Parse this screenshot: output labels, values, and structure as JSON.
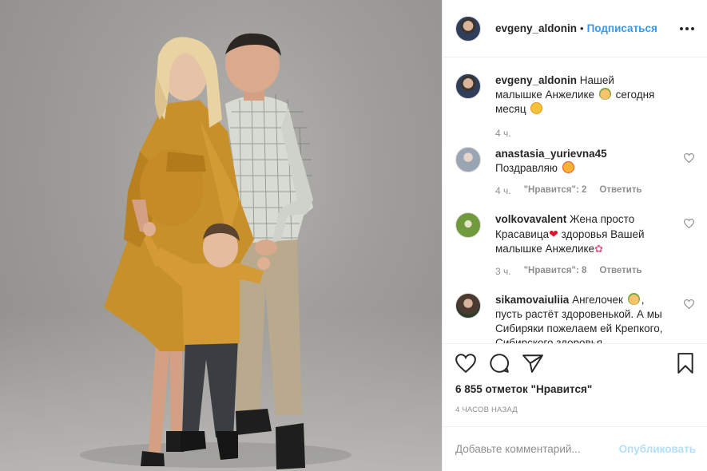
{
  "header": {
    "username": "evgeny_aldonin",
    "separator": "•",
    "follow_label": "Подписаться"
  },
  "caption": {
    "username": "evgeny_aldonin",
    "text_part1": "Нашей малышке Анжелике",
    "text_part2": "сегодня месяц",
    "time": "4 ч."
  },
  "comments": [
    {
      "username": "anastasia_yurievna45",
      "text": "Поздравляю",
      "time": "4 ч.",
      "likes": "\"Нравится\": 2",
      "reply": "Ответить"
    },
    {
      "username": "volkovavalent",
      "text_part1": "Жена просто Красавица",
      "text_part2": "здоровья Вашей малышке Анжелике",
      "time": "3 ч.",
      "likes": "\"Нравится\": 8",
      "reply": "Ответить"
    },
    {
      "username": "sikamovaiuliia",
      "text_part1": "Ангелочек",
      "text_part2": ", пусть растёт здоровенькой. А мы Сибиряки пожелаем ей Крепкого, Сибирского здоровья"
    }
  ],
  "likes_count": "6 855 отметок \"Нравится\"",
  "time_ago": "4 ЧАСОВ НАЗАД",
  "add_comment": {
    "placeholder": "Добавьте комментарий...",
    "publish_label": "Опубликовать"
  },
  "colors": {
    "accent": "#3897f0",
    "publish_disabled": "#b2dffc",
    "meta_gray": "#8e8e8e",
    "dress": "#c8902a"
  },
  "icons": [
    "heart-icon",
    "comment-icon",
    "share-icon",
    "bookmark-icon",
    "more-icon"
  ]
}
